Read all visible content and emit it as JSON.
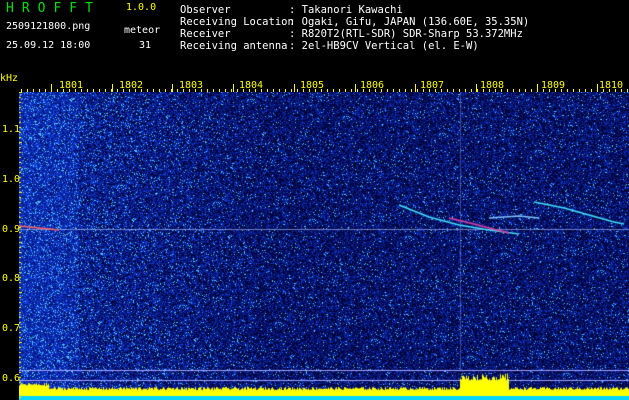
{
  "app": {
    "name": "HROFFT",
    "version": "1.0.0",
    "file_name": "2509121800.png",
    "timestamp": "25.09.12 18:00",
    "meteor_label": "meteor",
    "meteor_count": "31"
  },
  "info": [
    {
      "label": "Observer",
      "value": ": Takanori Kawachi"
    },
    {
      "label": "Receiving Location",
      "value": ": Ogaki, Gifu, JAPAN (136.60E, 35.35N)"
    },
    {
      "label": "Receiver",
      "value": ": R820T2(RTL-SDR) SDR-Sharp 53.372MHz"
    },
    {
      "label": "Receiving antenna",
      "value": ": 2el-HB9CV Vertical (el. E-W)"
    }
  ],
  "axes": {
    "y_unit": "kHz",
    "x_ticks": [
      "1801",
      "1802",
      "1803",
      "1804",
      "1805",
      "1806",
      "1807",
      "1808",
      "1809",
      "1810"
    ],
    "y_ticks": [
      "1.1",
      "1.0",
      "0.9",
      "0.8",
      "0.7",
      "0.6"
    ]
  },
  "colors": {
    "background": "#000000",
    "label_yellow": "#ffff00",
    "title_green": "#00e000",
    "noise_blue": "#1030c0",
    "echo_cyan": "#40e0ff",
    "marker_line": "#a0a0ff"
  }
}
